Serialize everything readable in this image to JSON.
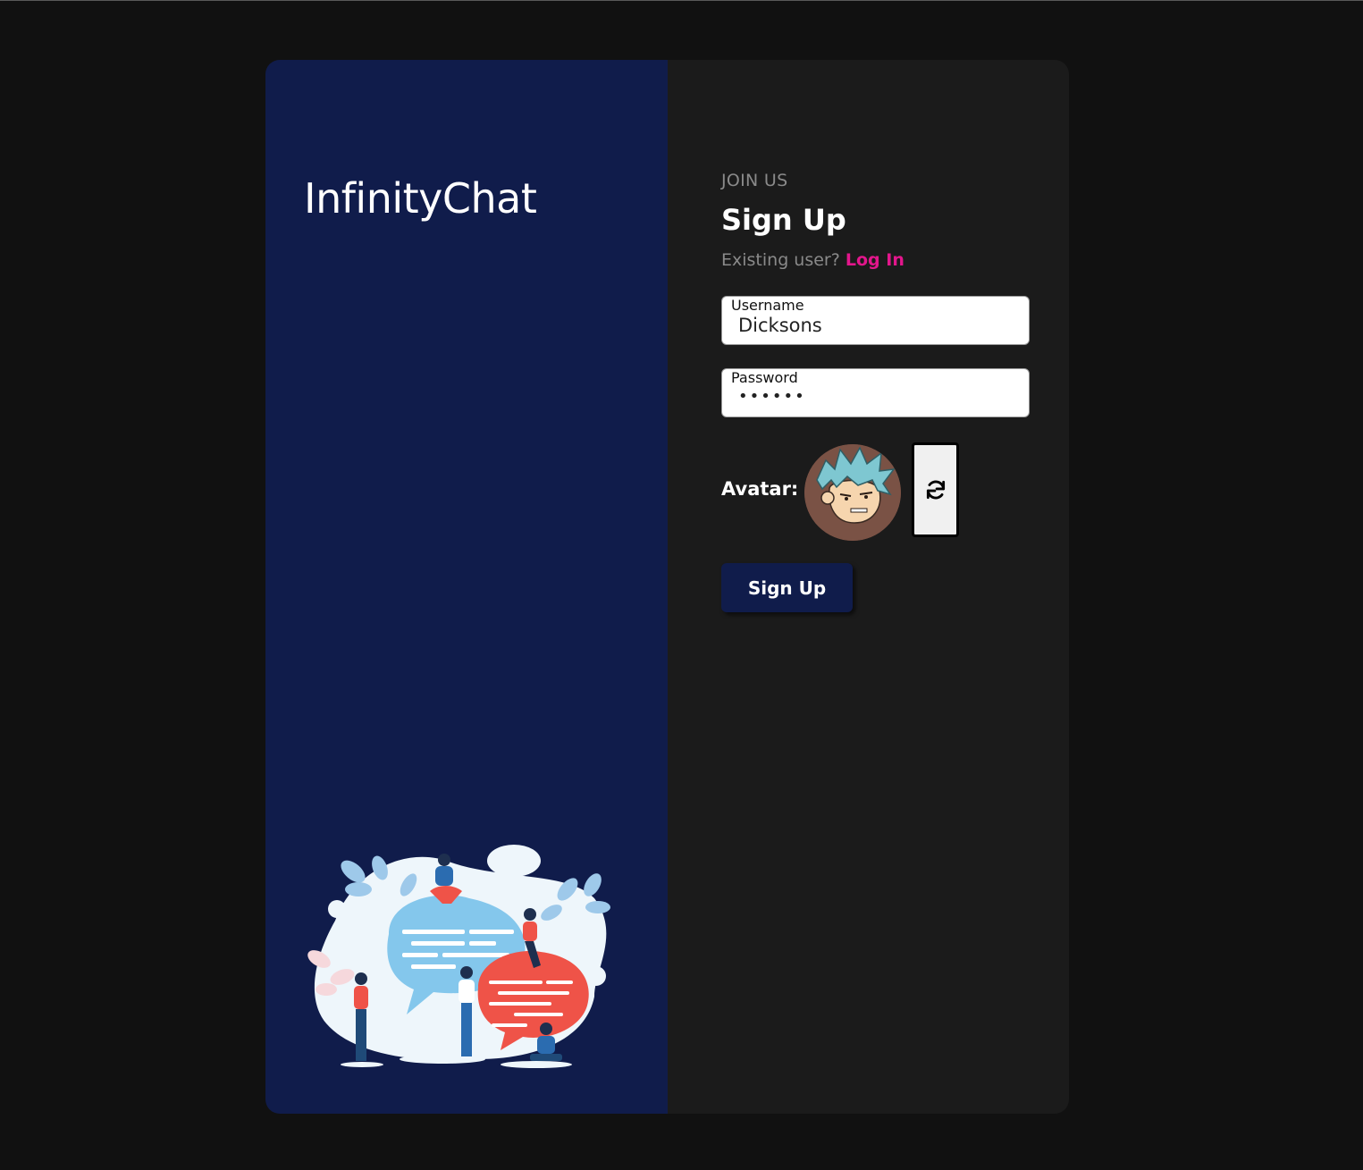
{
  "brand": {
    "name": "InfinityChat"
  },
  "form": {
    "eyebrow": "JOIN US",
    "title": "Sign Up",
    "existing_prompt": "Existing user?",
    "login_link": "Log In",
    "username": {
      "label": "Username",
      "value": "Dicksons"
    },
    "password": {
      "label": "Password",
      "value": "••••••"
    },
    "avatar_label": "Avatar:",
    "submit_label": "Sign Up"
  },
  "icons": {
    "refresh": "refresh-icon"
  },
  "colors": {
    "page_bg": "#111111",
    "left_panel": "#101c4b",
    "right_panel": "#1b1b1b",
    "accent_link": "#e3168c",
    "button_bg": "#101c4b"
  }
}
